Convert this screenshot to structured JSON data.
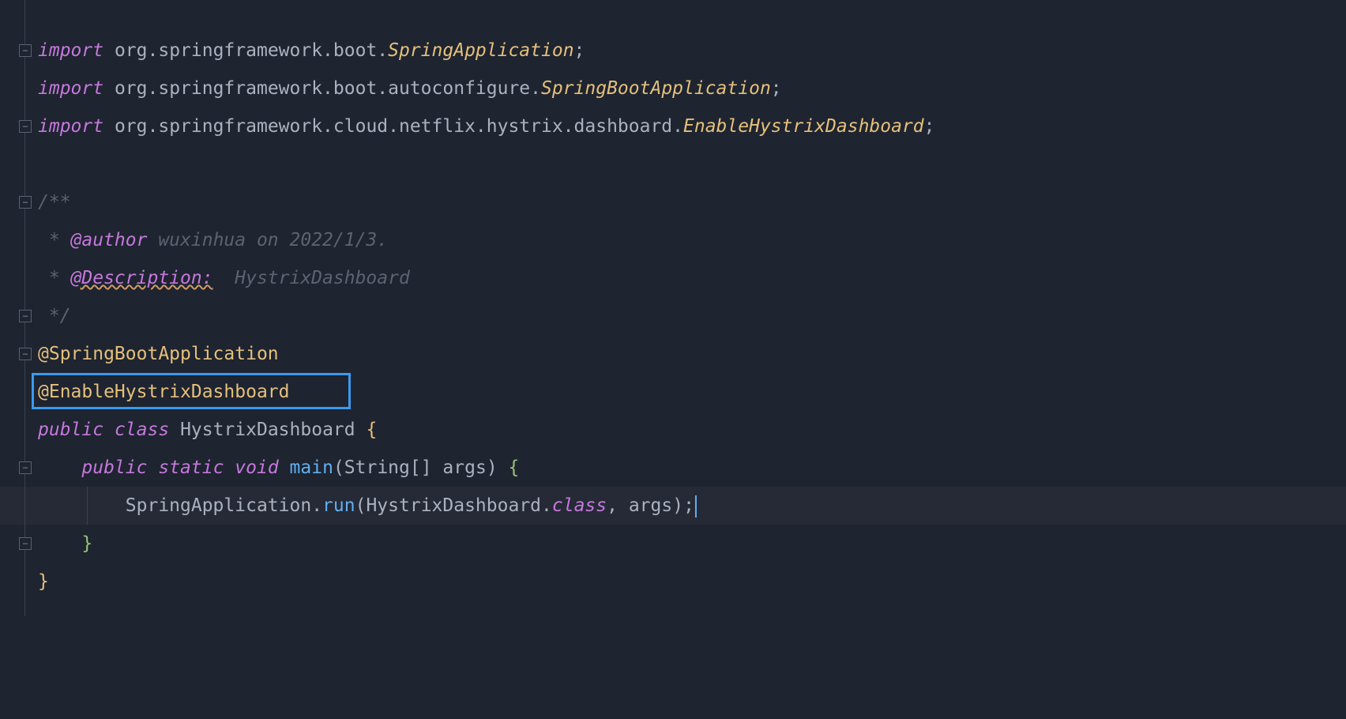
{
  "imports": [
    {
      "kw": "import",
      "pkg": "org.springframework.boot.",
      "cls": "SpringApplication",
      "semi": ";"
    },
    {
      "kw": "import",
      "pkg": "org.springframework.boot.autoconfigure.",
      "cls": "SpringBootApplication",
      "semi": ";"
    },
    {
      "kw": "import",
      "pkg": "org.springframework.cloud.netflix.hystrix.dashboard.",
      "cls": "EnableHystrixDashboard",
      "semi": ";"
    }
  ],
  "doc": {
    "open": "/**",
    "author_prefix": " * ",
    "author_tag": "@author",
    "author_text": " wuxinhua on 2022/1/3.",
    "desc_prefix": " * ",
    "desc_tag": "@Description:",
    "desc_text": "  HystrixDashboard",
    "close": " */"
  },
  "annotations": {
    "spring": "@SpringBootApplication",
    "hystrix": "@EnableHystrixDashboard"
  },
  "classDecl": {
    "public": "public",
    "classKw": "class",
    "name": "HystrixDashboard",
    "open": "{"
  },
  "method": {
    "indent": "    ",
    "public": "public",
    "static": "static",
    "void": "void",
    "name": "main",
    "lp": "(",
    "ptype": "String[]",
    "pname": " args",
    "rp": ")",
    "open": "{"
  },
  "body": {
    "indent": "        ",
    "obj": "SpringApplication",
    "dot": ".",
    "call": "run",
    "lp": "(",
    "arg1": "HystrixDashboard",
    "dot2": ".",
    "classKw": "class",
    "comma": ",",
    "arg2": " args",
    "rp": ")",
    "semi": ";"
  },
  "close": {
    "methodIndent": "    ",
    "methodBrace": "}",
    "classBrace": "}"
  }
}
